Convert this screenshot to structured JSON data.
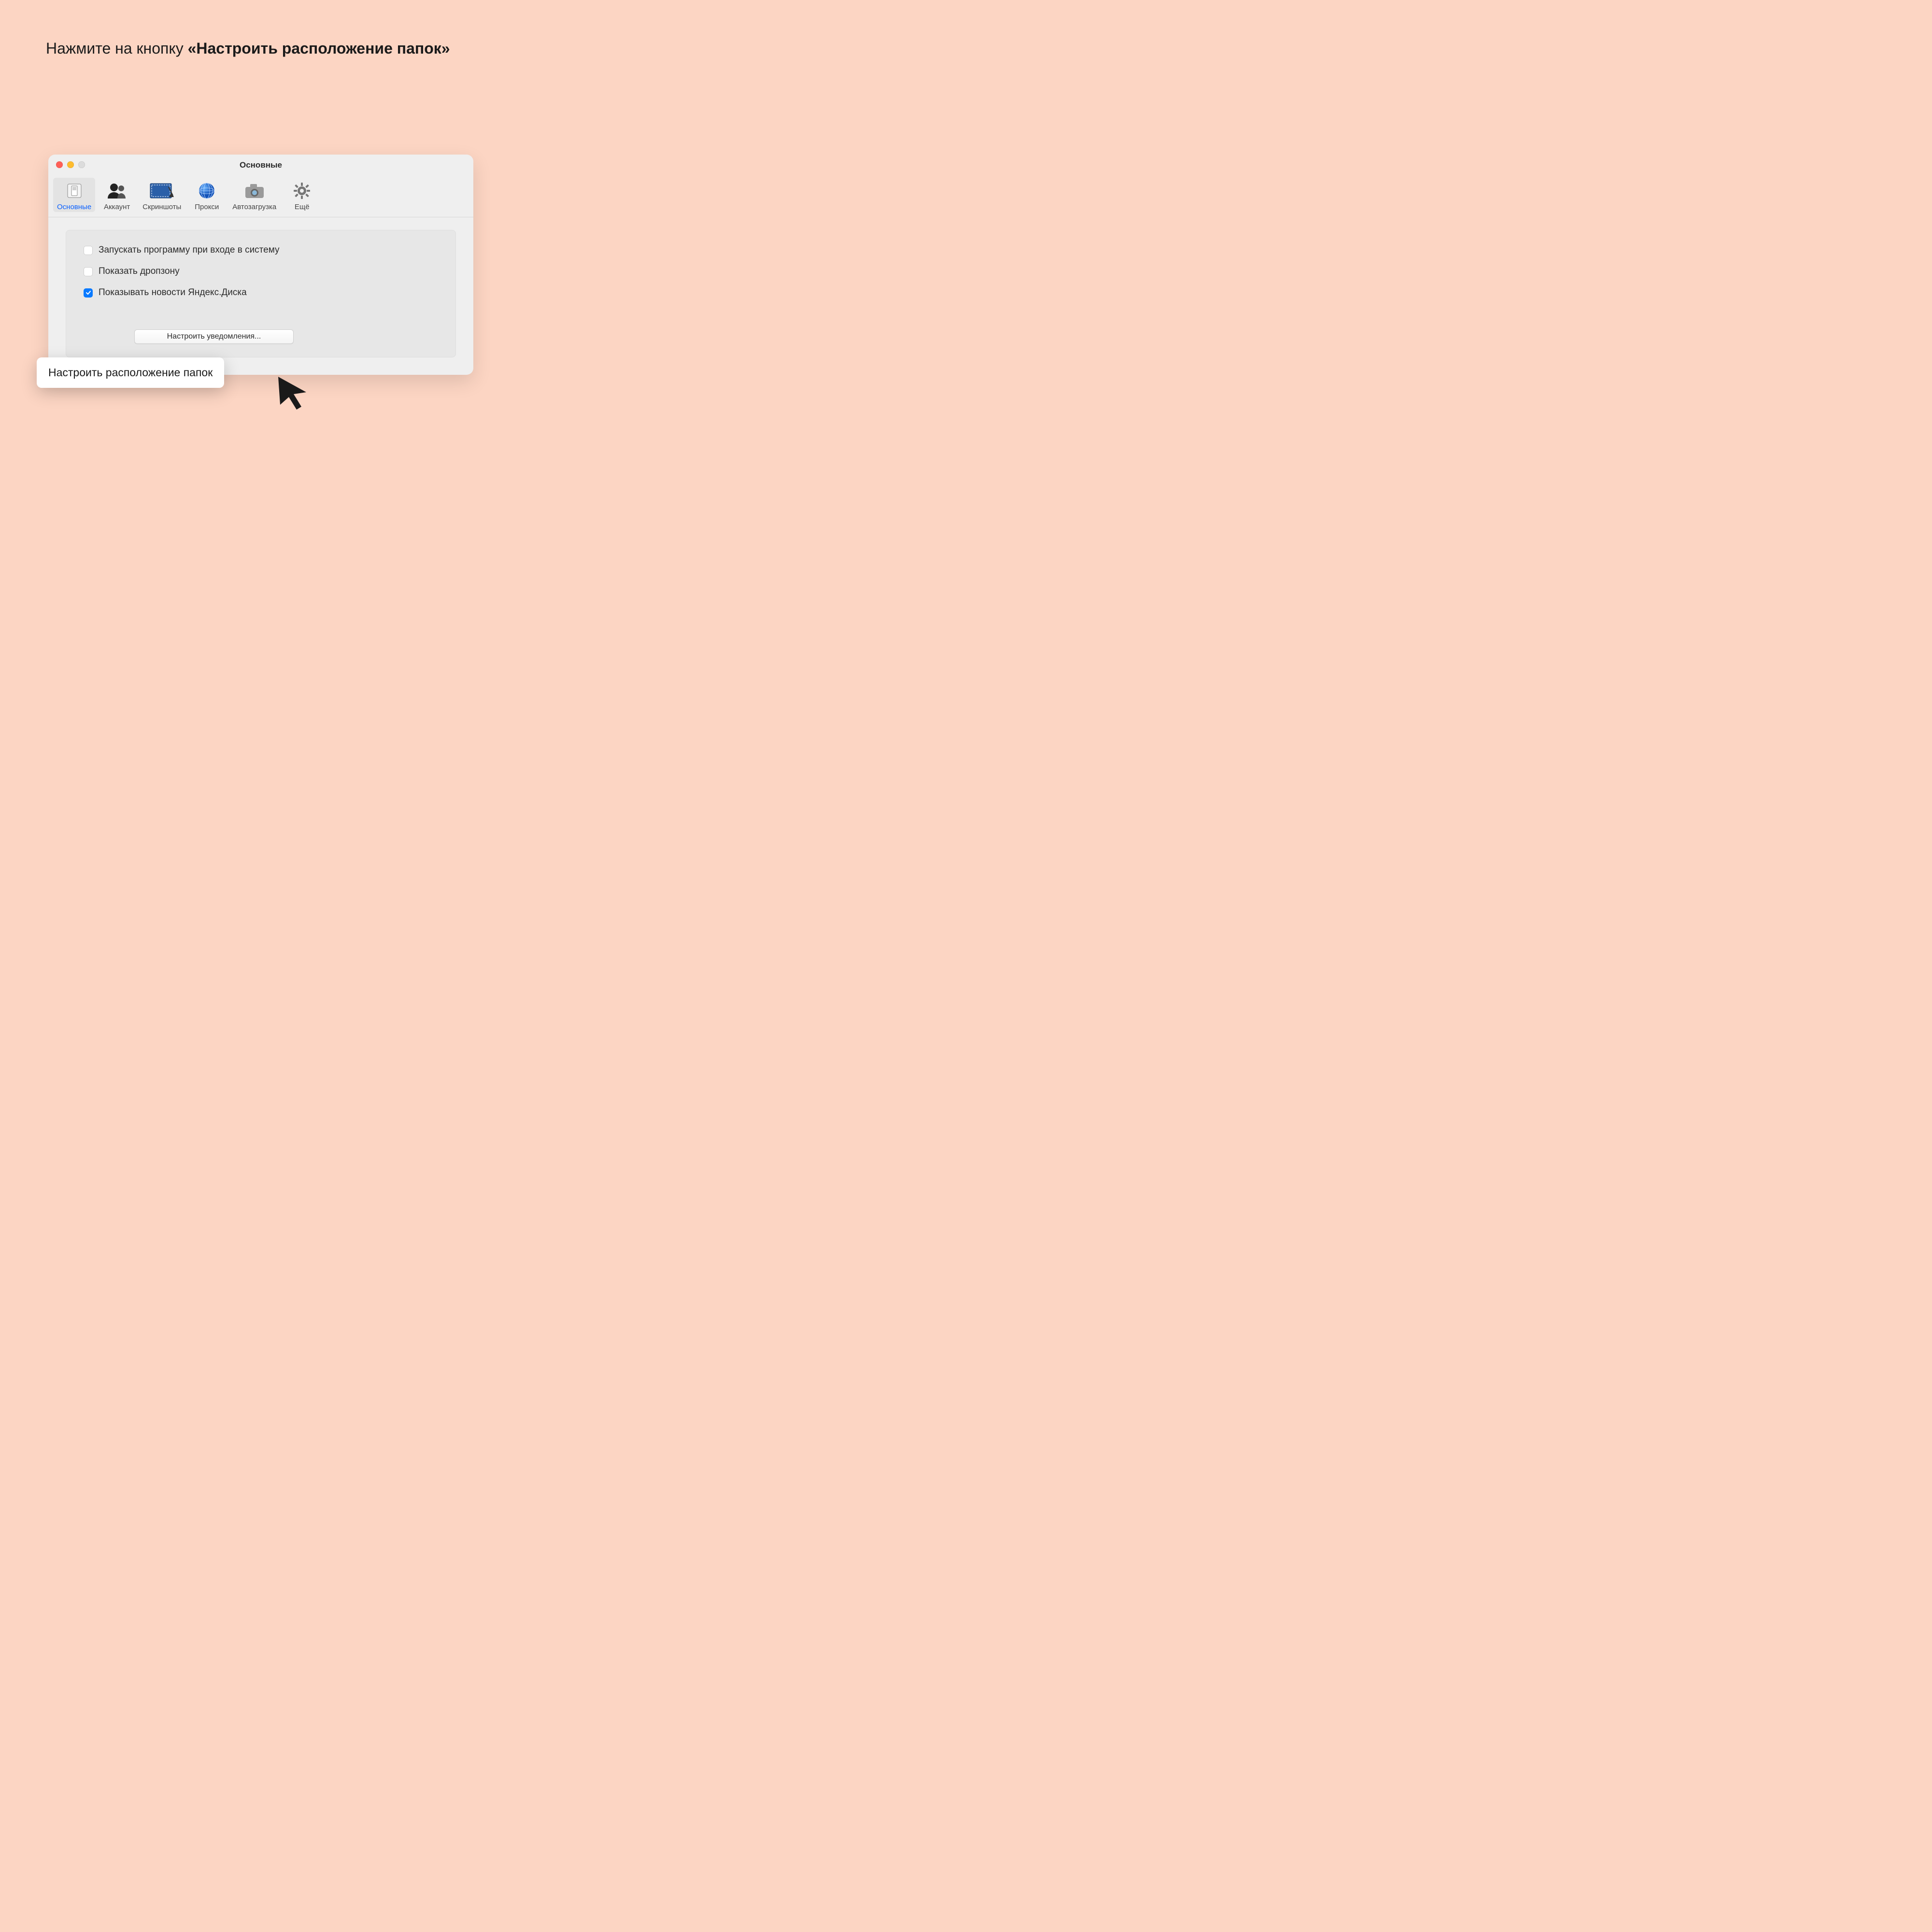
{
  "instruction": {
    "prefix": "Нажмите на кнопку ",
    "bold": "«Настроить расположение папок»"
  },
  "window": {
    "title": "Основные"
  },
  "toolbar": {
    "items": [
      {
        "label": "Основные"
      },
      {
        "label": "Аккаунт"
      },
      {
        "label": "Скриншоты"
      },
      {
        "label": "Прокси"
      },
      {
        "label": "Автозагрузка"
      },
      {
        "label": "Ещё"
      }
    ]
  },
  "checkboxes": [
    {
      "label": "Запускать программу при входе в систему",
      "checked": false
    },
    {
      "label": "Показать дропзону",
      "checked": false
    },
    {
      "label": "Показывать новости Яндекс.Диска",
      "checked": true
    }
  ],
  "tooltip": "Настроить расположение папок",
  "button_notifications": "Настроить уведомления..."
}
